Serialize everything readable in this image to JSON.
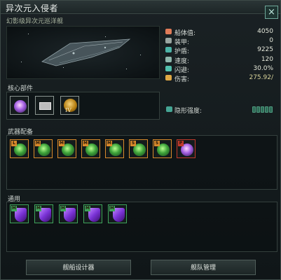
{
  "window": {
    "title": "异次元入侵者",
    "subtitle": "幻影级异次元巡洋舰"
  },
  "icons": {
    "close": "×"
  },
  "stats": [
    {
      "label": "船体值:",
      "value": "4050",
      "icon": "heart-icon",
      "color": "#e07b58"
    },
    {
      "label": "装甲:",
      "value": "0",
      "icon": "armor-icon",
      "color": "#9aa6a2"
    },
    {
      "label": "护盾:",
      "value": "9225",
      "icon": "shield-icon",
      "color": "#4cb3a7"
    },
    {
      "label": "速度:",
      "value": "120",
      "icon": "speed-icon",
      "color": "#8fb7ad"
    },
    {
      "label": "闪避:",
      "value": "30.0%",
      "icon": "evasion-icon",
      "color": "#52c0ad"
    },
    {
      "label": "伤害:",
      "value": "275.92/",
      "icon": "damage-icon",
      "color": "#e0a844"
    }
  ],
  "stealth": {
    "label": "隐形强度:"
  },
  "sections": {
    "core": "核心部件",
    "weapons": "武器配备",
    "utility": "通用"
  },
  "core_components": [
    {
      "name": "reactor-component",
      "tag": ""
    },
    {
      "name": "computer-component",
      "tag": ""
    },
    {
      "name": "thruster-component",
      "tag": "IV"
    }
  ],
  "weapons": [
    {
      "tag": "L",
      "tagColor": "#d98a2b"
    },
    {
      "tag": "M",
      "tagColor": "#d98a2b"
    },
    {
      "tag": "M",
      "tagColor": "#d98a2b"
    },
    {
      "tag": "M",
      "tagColor": "#d98a2b"
    },
    {
      "tag": "M",
      "tagColor": "#d98a2b"
    },
    {
      "tag": "S",
      "tagColor": "#d98a2b"
    },
    {
      "tag": "S",
      "tagColor": "#d98a2b"
    },
    {
      "tag": "P",
      "tagColor": "#c0392b"
    }
  ],
  "utilities": [
    {
      "tag": "M",
      "tagColor": "#3fa35a"
    },
    {
      "tag": "M",
      "tagColor": "#3fa35a"
    },
    {
      "tag": "M",
      "tagColor": "#3fa35a"
    },
    {
      "tag": "M",
      "tagColor": "#3fa35a"
    },
    {
      "tag": "M",
      "tagColor": "#3fa35a"
    }
  ],
  "buttons": {
    "ship_designer": "舰船设计器",
    "fleet_manager": "舰队管理"
  }
}
